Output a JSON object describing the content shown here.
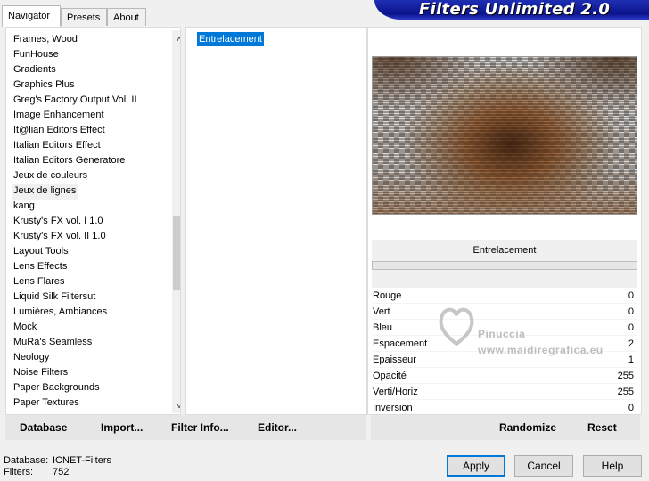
{
  "tabs": [
    {
      "label": "Navigator"
    },
    {
      "label": "Presets"
    },
    {
      "label": "About"
    }
  ],
  "brand": {
    "title": "Filters Unlimited 2.0",
    "accent": "#0b148c"
  },
  "filter_list": {
    "items": [
      "Frames, Wood",
      "FunHouse",
      "Gradients",
      "Graphics Plus",
      "Greg's Factory Output Vol. II",
      "Image Enhancement",
      "It@lian Editors Effect",
      "Italian Editors Effect",
      "Italian Editors Generatore",
      "Jeux de couleurs",
      "Jeux de lignes",
      "kang",
      "Krusty's FX vol. I 1.0",
      "Krusty's FX vol. II 1.0",
      "Layout Tools",
      "Lens Effects",
      "Lens Flares",
      "Liquid Silk Filtersut",
      "Lumières, Ambiances",
      "Mock",
      "MuRa's Seamless",
      "Neology",
      "Noise Filters",
      "Paper Backgrounds",
      "Paper Textures"
    ],
    "selected": "Jeux de lignes",
    "up_icon": "chevron-up-icon",
    "down_icon": "chevron-down-icon"
  },
  "effect_list": {
    "items": [
      "Entrelacement"
    ],
    "selected": "Entrelacement",
    "highlight_color": "#0078d7"
  },
  "preview": {
    "effect_name": "Entrelacement"
  },
  "parameters": [
    {
      "name": "Rouge",
      "value": "0"
    },
    {
      "name": "Vert",
      "value": "0"
    },
    {
      "name": "Bleu",
      "value": "0"
    },
    {
      "name": "Espacement",
      "value": "2"
    },
    {
      "name": "Epaisseur",
      "value": "1"
    },
    {
      "name": "Opacité",
      "value": "255"
    },
    {
      "name": "Verti/Horiz",
      "value": "255"
    },
    {
      "name": "Inversion",
      "value": "0"
    }
  ],
  "watermark": {
    "line1": "Pinuccia",
    "line2": "www.maidiregrafica.eu"
  },
  "link_buttons": {
    "database": "Database",
    "import": "Import...",
    "filter_info": "Filter Info...",
    "editor": "Editor...",
    "randomize": "Randomize",
    "reset": "Reset"
  },
  "status": {
    "database_label": "Database:",
    "database_value": "ICNET-Filters",
    "filters_label": "Filters:",
    "filters_value": "752"
  },
  "buttons": {
    "apply": "Apply",
    "cancel": "Cancel",
    "help": "Help"
  }
}
